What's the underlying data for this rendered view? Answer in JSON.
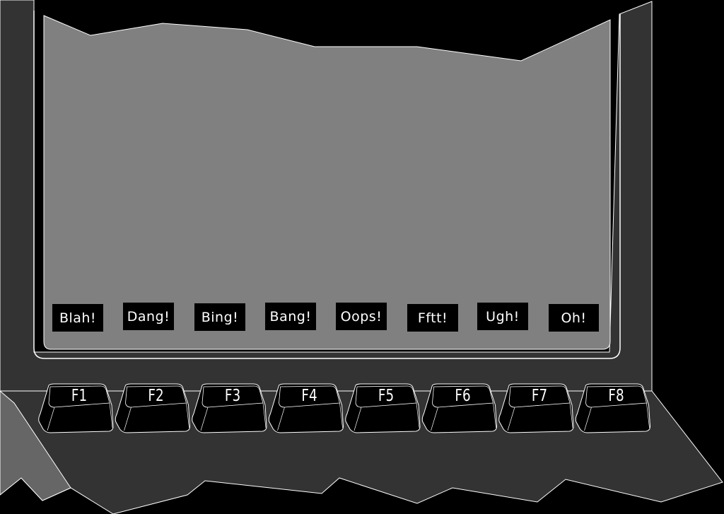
{
  "screen": {
    "soft_labels": [
      "Blah!",
      "Dang!",
      "Bing!",
      "Bang!",
      "Oops!",
      "Fftt!",
      "Ugh!",
      "Oh!"
    ]
  },
  "keys": [
    "F1",
    "F2",
    "F3",
    "F4",
    "F5",
    "F6",
    "F7",
    "F8"
  ],
  "colors": {
    "background": "#000000",
    "bezel": "#333333",
    "screen": "#808080",
    "key": "#000000",
    "outline": "#ffffff"
  }
}
